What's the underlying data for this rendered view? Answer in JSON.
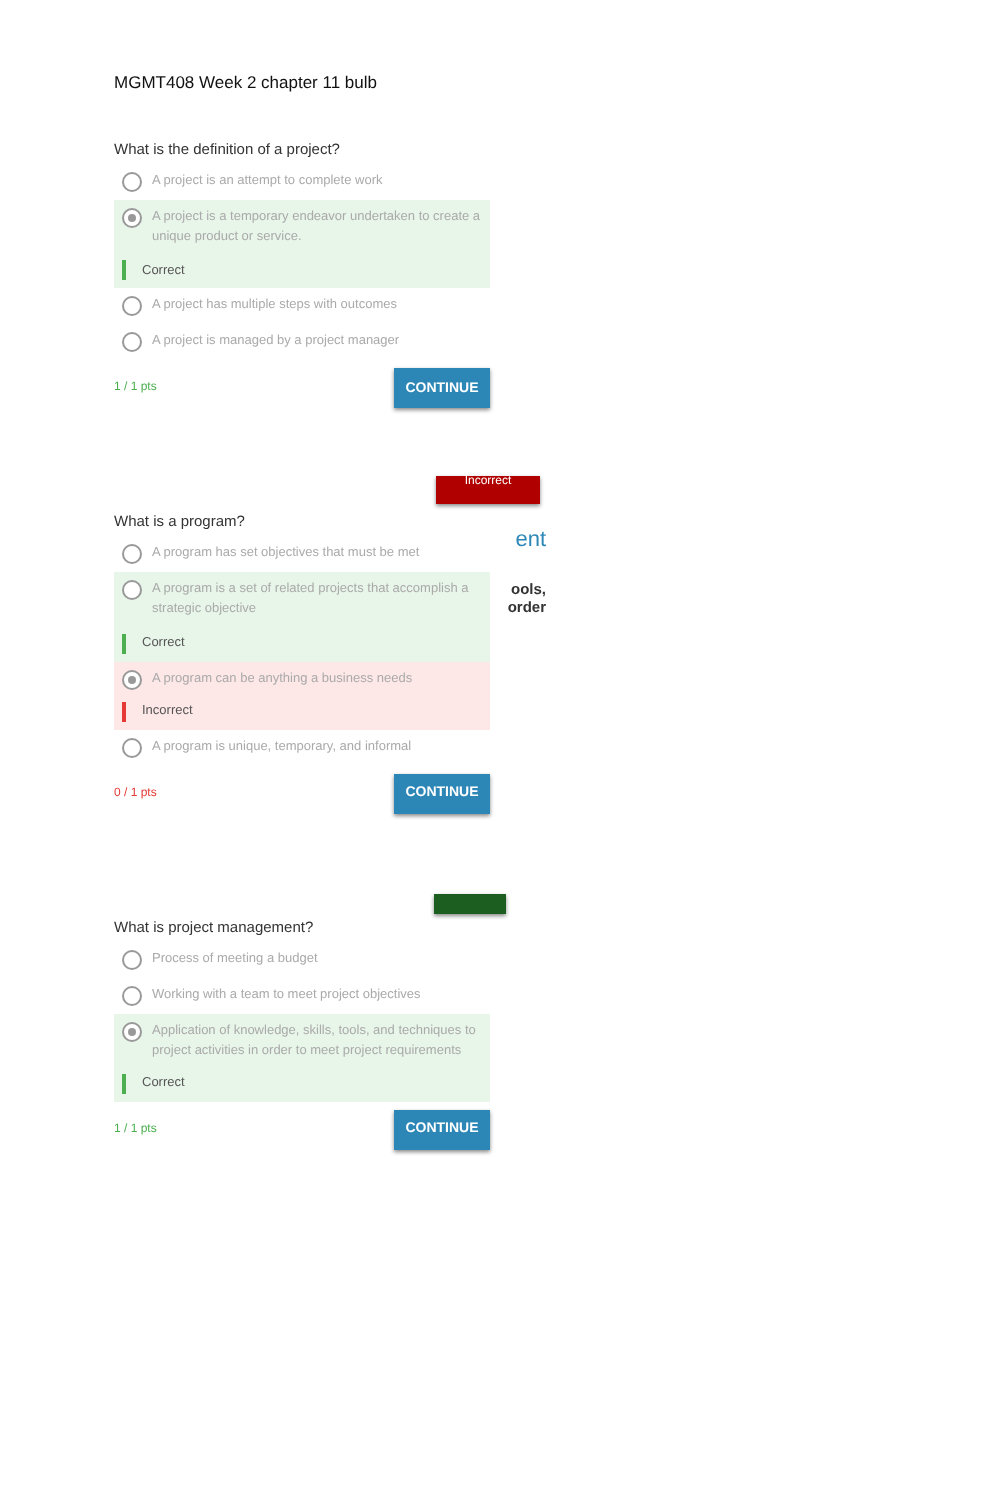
{
  "document_title": "MGMT408 Week 2 chapter 11 bulb",
  "questions": [
    {
      "question": "What is the definition of a project?",
      "options": [
        {
          "text": "A project is an attempt to complete work",
          "selected": false
        },
        {
          "text": "A project is a temporary endeavor undertaken to create a unique product or service.",
          "selected": true,
          "feedback": {
            "kind": "correct",
            "label": "Correct"
          }
        },
        {
          "text": "A project has multiple steps with outcomes",
          "selected": false
        },
        {
          "text": "A project is managed by a project manager",
          "selected": false
        }
      ],
      "score": {
        "kind": "correct",
        "text": "1 / 1 pts"
      },
      "button": "CONTINUE"
    },
    {
      "question": "What is a program?",
      "banner": {
        "kind": "incorrect",
        "label": "Incorrect"
      },
      "side_text": [
        "ent",
        "ools,",
        "order"
      ],
      "options": [
        {
          "text": "A program has set objectives that must be met",
          "selected": false
        },
        {
          "text": "A program is a set of related projects that accomplish a strategic objective",
          "selected": false,
          "feedback": {
            "kind": "correct",
            "label": "Correct"
          }
        },
        {
          "text": "A program can be anything a business needs",
          "selected": true,
          "feedback": {
            "kind": "incorrect",
            "label": "Incorrect"
          }
        },
        {
          "text": "A program is unique, temporary, and informal",
          "selected": false
        }
      ],
      "score": {
        "kind": "incorrect",
        "text": "0 / 1 pts"
      },
      "button": "CONTINUE"
    },
    {
      "question": "What is project management?",
      "banner": {
        "kind": "correct"
      },
      "options": [
        {
          "text": "Process of meeting a budget",
          "selected": false
        },
        {
          "text": "Working with a team to meet project objectives",
          "selected": false
        },
        {
          "text": "Application of knowledge, skills, tools, and techniques to project activities in order to meet project requirements",
          "selected": true,
          "feedback": {
            "kind": "correct",
            "label": "Correct"
          }
        }
      ],
      "score": {
        "kind": "correct",
        "text": "1 / 1 pts"
      },
      "button": "CONTINUE"
    }
  ]
}
